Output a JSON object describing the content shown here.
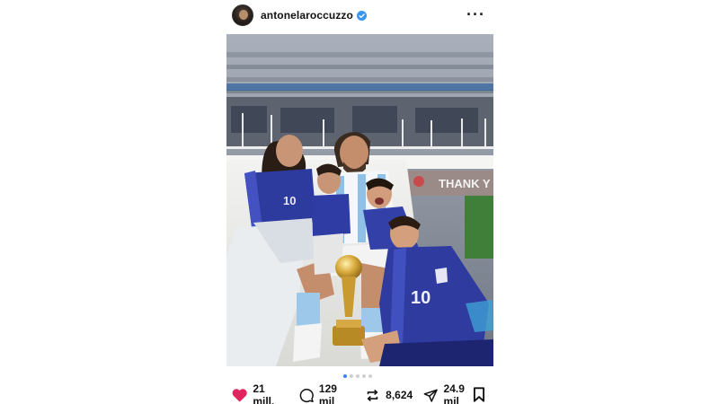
{
  "post": {
    "username": "antonelaroccuzzo",
    "verified": true,
    "more_icon": "ellipsis-icon",
    "carousel": {
      "count": 5,
      "active_index": 0
    }
  },
  "photo": {
    "banner_text": "THANK Y",
    "jersey_number": "10"
  },
  "actions": {
    "likes": "21 mill.",
    "comments": "129 mil",
    "reposts": "8,624",
    "shares": "24.9 mil"
  },
  "colors": {
    "like_red": "#e0245e",
    "verified_blue": "#3897f0",
    "carousel_active": "#3b82f6"
  }
}
